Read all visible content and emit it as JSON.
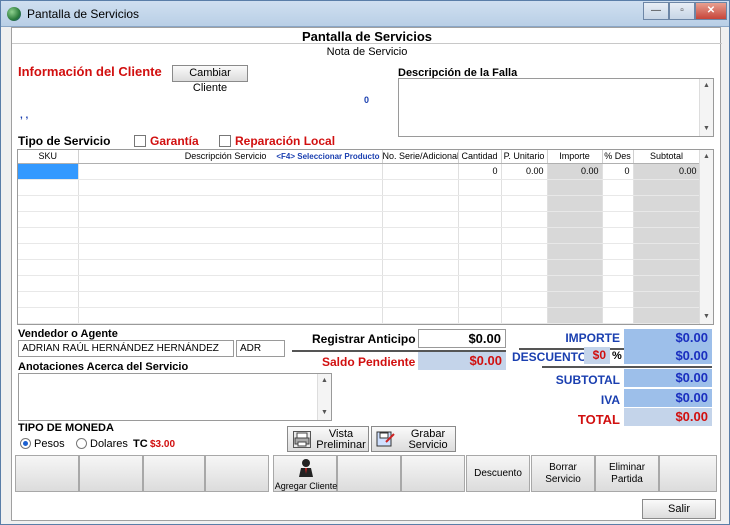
{
  "window": {
    "title": "Pantalla de Servicios",
    "btn_min": "—",
    "btn_max": "▫",
    "btn_close": "✕"
  },
  "header": {
    "title": "Pantalla de Servicios",
    "subtitle": "Nota de Servicio"
  },
  "cliente": {
    "section_title": "Información del Cliente",
    "change_button": "Cambiar Cliente",
    "count": "0",
    "name_line": ", ,"
  },
  "falla": {
    "label": "Descripción de la Falla"
  },
  "servicio": {
    "label": "Tipo de Servicio",
    "garantia": "Garantía",
    "reparacion": "Reparación Local"
  },
  "grid": {
    "headers": [
      "SKU",
      "Descripción Servicio",
      "No. Serie/Adicional",
      "Cantidad",
      "P. Unitario",
      "Importe",
      "% Des",
      "Subtotal"
    ],
    "hint": "<F4> Seleccionar Producto",
    "first_row": [
      "",
      "",
      "",
      "0",
      "0.00",
      "0.00",
      "0",
      "0.00"
    ]
  },
  "vendedor": {
    "label": "Vendedor o Agente",
    "name": "ADRIAN RAÚL HERNÁNDEZ HERNÁNDEZ",
    "code": "ADR"
  },
  "anotaciones": {
    "label": "Anotaciones Acerca del Servicio"
  },
  "anticipo": {
    "label": "Registrar Anticipo",
    "value": "$0.00",
    "saldo_label": "Saldo Pendiente",
    "saldo_value": "$0.00"
  },
  "totales": {
    "importe_label": "IMPORTE",
    "importe": "$0.00",
    "descuento_label": "DESCUENTO",
    "descuento_pct": "$0",
    "pct_sign": "%",
    "descuento": "$0.00",
    "subtotal_label": "SUBTOTAL",
    "subtotal": "$0.00",
    "iva_label": "IVA",
    "iva": "$0.00",
    "total_label": "TOTAL",
    "total": "$0.00"
  },
  "moneda": {
    "label": "TIPO DE MONEDA",
    "pesos": "Pesos",
    "dolares": "Dolares",
    "tc_label": "TC",
    "tc_value": "$3.00"
  },
  "actions": {
    "vista_1": "Vista",
    "vista_2": "Preliminar",
    "grabar_1": "Grabar",
    "grabar_2": "Servicio",
    "agregar": "Agregar Cliente",
    "descuento": "Descuento",
    "borrar_1": "Borrar",
    "borrar_2": "Servicio",
    "eliminar_1": "Eliminar",
    "eliminar_2": "Partida",
    "salir": "Salir"
  }
}
